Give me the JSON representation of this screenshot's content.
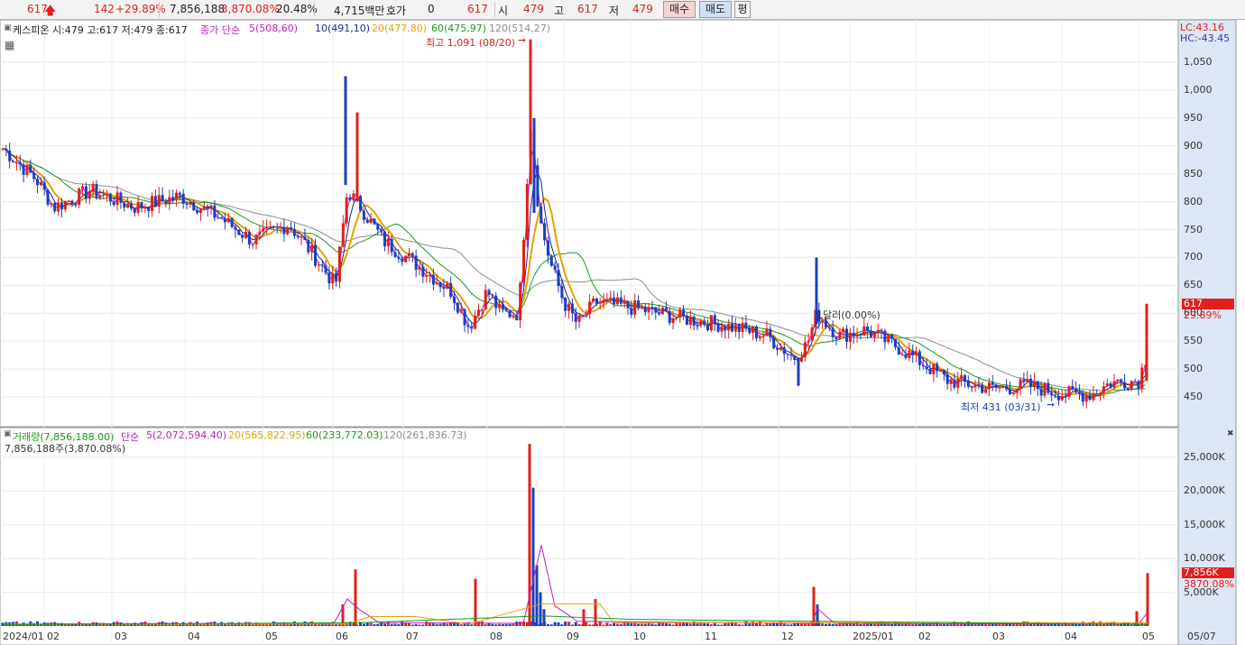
{
  "ticker": {
    "price": "617",
    "change": "142",
    "change_pct": "+29.89%",
    "volume": "7,856,188",
    "volume_pct": "3,870.08%",
    "turnover_pct": "20.48%",
    "amount": "4,715백만",
    "quote_label": "호가",
    "quote_value": "0",
    "quote_price": "617",
    "open_label": "시",
    "open": "479",
    "high_label": "고",
    "high": "617",
    "low_label": "저",
    "low": "479",
    "buy_label": "매수",
    "sell_label": "매도",
    "eval_label": "평"
  },
  "price_panel": {
    "stock_info": "케스피온 시:479 고:617 저:479 종:617",
    "ma_title": "종가 단순",
    "ma5": "5(508,60)",
    "ma10": "10(491,10)",
    "ma20": "20(477,80)",
    "ma60": "60(475,97)",
    "ma120": "120(514,27)",
    "lc": "LC:43.16",
    "hc": "HC:-43.45",
    "high_note": "최고 1,091 (08/20)",
    "low_note": "최저 431 (03/31)",
    "fx_note": "1달러(0.00%)",
    "last_price_tag": "617",
    "last_pct_tag": "29.89%",
    "y_labels": [
      "1,050",
      "1,000",
      "950",
      "900",
      "850",
      "800",
      "750",
      "700",
      "650",
      "600",
      "550",
      "500",
      "450"
    ]
  },
  "volume_panel": {
    "title": "거래량(7,856,188.00)",
    "ma_title": "단순",
    "ma5": "5(2,072,594.40)",
    "ma20": "20(565,822.95)",
    "ma60": "60(233,772.03)",
    "ma120": "120(261,836.73)",
    "volume_info": "7,856,188주(3,870.08%)",
    "last_vol_tag": "7,856K",
    "last_vol_pct": "3870.08%",
    "y_labels": [
      "25,000K",
      "20,000K",
      "15,000K",
      "10,000K",
      "5,000K"
    ]
  },
  "x_labels": [
    "2024/01",
    "02",
    "03",
    "04",
    "05",
    "06",
    "07",
    "08",
    "09",
    "10",
    "11",
    "12",
    "2025/01",
    "02",
    "03",
    "04",
    "05",
    "05/07"
  ],
  "colors": {
    "up": "#e0201b",
    "down": "#1b3fbf",
    "ma5": "#c020c0",
    "ma10": "#1b2a8f",
    "ma20": "#e8a000",
    "ma60": "#1a9a1a",
    "ma120": "#8c8c8c"
  }
}
